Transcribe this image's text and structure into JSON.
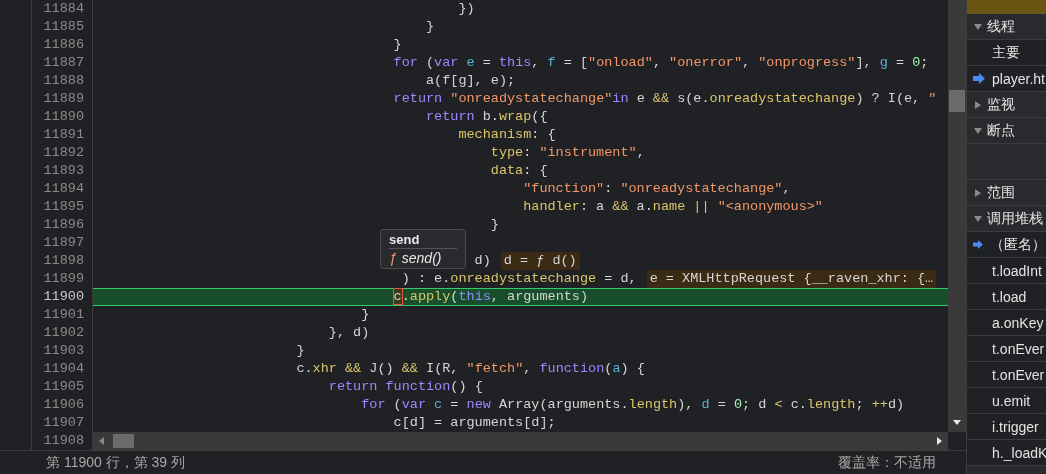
{
  "editor": {
    "lines": [
      {
        "number": "11884",
        "current": false,
        "tokens": [
          {
            "text": "                                            })",
            "kind": "plain"
          }
        ]
      },
      {
        "number": "11885",
        "current": false,
        "tokens": [
          {
            "text": "                                        }",
            "kind": "plain"
          }
        ]
      },
      {
        "number": "11886",
        "current": false,
        "tokens": [
          {
            "text": "                                    }",
            "kind": "plain"
          }
        ]
      },
      {
        "number": "11887",
        "current": false,
        "tokens": [
          {
            "text": "                                    for",
            "kind": "kw"
          },
          {
            "text": " (",
            "kind": "plain"
          },
          {
            "text": "var",
            "kind": "kw"
          },
          {
            "text": " e",
            "kind": "var"
          },
          {
            "text": " = ",
            "kind": "plain"
          },
          {
            "text": "this",
            "kind": "kw"
          },
          {
            "text": ", ",
            "kind": "plain"
          },
          {
            "text": "f",
            "kind": "var"
          },
          {
            "text": " = [",
            "kind": "plain"
          },
          {
            "text": "\"onload\"",
            "kind": "str"
          },
          {
            "text": ", ",
            "kind": "plain"
          },
          {
            "text": "\"onerror\"",
            "kind": "str"
          },
          {
            "text": ", ",
            "kind": "plain"
          },
          {
            "text": "\"onprogress\"",
            "kind": "str"
          },
          {
            "text": "], ",
            "kind": "plain"
          },
          {
            "text": "g",
            "kind": "var"
          },
          {
            "text": " = ",
            "kind": "plain"
          },
          {
            "text": "0",
            "kind": "num"
          },
          {
            "text": ";",
            "kind": "plain"
          }
        ]
      },
      {
        "number": "11888",
        "current": false,
        "tokens": [
          {
            "text": "                                        a(f[g], e);",
            "kind": "plain"
          }
        ]
      },
      {
        "number": "11889",
        "current": false,
        "tokens": [
          {
            "text": "                                    return",
            "kind": "kw"
          },
          {
            "text": " \"onreadystatechange\"",
            "kind": "str"
          },
          {
            "text": "in",
            "kind": "kw"
          },
          {
            "text": " e ",
            "kind": "plain"
          },
          {
            "text": "&&",
            "kind": "op"
          },
          {
            "text": " s(e.",
            "kind": "plain"
          },
          {
            "text": "onreadystatechange",
            "kind": "prop"
          },
          {
            "text": ") ? I(e, ",
            "kind": "plain"
          },
          {
            "text": "\"",
            "kind": "str"
          }
        ]
      },
      {
        "number": "11890",
        "current": false,
        "tokens": [
          {
            "text": "                                        return",
            "kind": "kw"
          },
          {
            "text": " b.",
            "kind": "plain"
          },
          {
            "text": "wrap",
            "kind": "prop"
          },
          {
            "text": "({",
            "kind": "plain"
          }
        ]
      },
      {
        "number": "11891",
        "current": false,
        "tokens": [
          {
            "text": "                                            mechanism",
            "kind": "prop"
          },
          {
            "text": ": {",
            "kind": "plain"
          }
        ]
      },
      {
        "number": "11892",
        "current": false,
        "tokens": [
          {
            "text": "                                                type",
            "kind": "prop"
          },
          {
            "text": ": ",
            "kind": "plain"
          },
          {
            "text": "\"instrument\"",
            "kind": "str"
          },
          {
            "text": ",",
            "kind": "plain"
          }
        ]
      },
      {
        "number": "11893",
        "current": false,
        "tokens": [
          {
            "text": "                                                data",
            "kind": "prop"
          },
          {
            "text": ": {",
            "kind": "plain"
          }
        ]
      },
      {
        "number": "11894",
        "current": false,
        "tokens": [
          {
            "text": "                                                    \"function\"",
            "kind": "str"
          },
          {
            "text": ": ",
            "kind": "plain"
          },
          {
            "text": "\"onreadystatechange\"",
            "kind": "str"
          },
          {
            "text": ",",
            "kind": "plain"
          }
        ]
      },
      {
        "number": "11895",
        "current": false,
        "tokens": [
          {
            "text": "                                                    handler",
            "kind": "prop"
          },
          {
            "text": ": a ",
            "kind": "plain"
          },
          {
            "text": "&&",
            "kind": "op"
          },
          {
            "text": " a.",
            "kind": "plain"
          },
          {
            "text": "name",
            "kind": "prop"
          },
          {
            "text": " ||",
            "kind": "op"
          },
          {
            "text": " \"<anonymous>\"",
            "kind": "str"
          }
        ]
      },
      {
        "number": "11896",
        "current": false,
        "tokens": [
          {
            "text": "                                                }",
            "kind": "plain"
          }
        ]
      },
      {
        "number": "11897",
        "current": false
      },
      {
        "number": "11898",
        "current": false,
        "tokens": [
          {
            "text": "                                              d)",
            "kind": "plain"
          }
        ],
        "inline_value": "d = ƒ d()"
      },
      {
        "number": "11899",
        "current": false,
        "tokens": [
          {
            "text": "                                     ) : e.",
            "kind": "plain"
          },
          {
            "text": "onreadystatechange",
            "kind": "prop"
          },
          {
            "text": " = d,",
            "kind": "plain"
          }
        ],
        "inline_value": "e = XMLHttpRequest {__raven_xhr: {…"
      },
      {
        "number": "11900",
        "current": true,
        "tokens": [
          {
            "text": "                                    c",
            "kind": "paused"
          },
          {
            "text": ".",
            "kind": "plain"
          },
          {
            "text": "apply",
            "kind": "prop"
          },
          {
            "text": "(",
            "kind": "plain"
          },
          {
            "text": "this",
            "kind": "kw"
          },
          {
            "text": ", arguments)",
            "kind": "plain"
          }
        ]
      },
      {
        "number": "11901",
        "current": false,
        "tokens": [
          {
            "text": "                                }",
            "kind": "plain"
          }
        ]
      },
      {
        "number": "11902",
        "current": false,
        "tokens": [
          {
            "text": "                            }, d)",
            "kind": "plain"
          }
        ]
      },
      {
        "number": "11903",
        "current": false,
        "tokens": [
          {
            "text": "                        }",
            "kind": "plain"
          }
        ]
      },
      {
        "number": "11904",
        "current": false,
        "tokens": [
          {
            "text": "                        c.",
            "kind": "plain"
          },
          {
            "text": "xhr",
            "kind": "prop"
          },
          {
            "text": " &&",
            "kind": "op"
          },
          {
            "text": " J() ",
            "kind": "plain"
          },
          {
            "text": "&&",
            "kind": "op"
          },
          {
            "text": " I(R, ",
            "kind": "plain"
          },
          {
            "text": "\"fetch\"",
            "kind": "str"
          },
          {
            "text": ", ",
            "kind": "plain"
          },
          {
            "text": "function",
            "kind": "kw"
          },
          {
            "text": "(",
            "kind": "plain"
          },
          {
            "text": "a",
            "kind": "var"
          },
          {
            "text": ") {",
            "kind": "plain"
          }
        ]
      },
      {
        "number": "11905",
        "current": false,
        "tokens": [
          {
            "text": "                            return",
            "kind": "kw"
          },
          {
            "text": " function",
            "kind": "kw"
          },
          {
            "text": "() {",
            "kind": "plain"
          }
        ]
      },
      {
        "number": "11906",
        "current": false,
        "tokens": [
          {
            "text": "                                for",
            "kind": "kw"
          },
          {
            "text": " (",
            "kind": "plain"
          },
          {
            "text": "var",
            "kind": "kw"
          },
          {
            "text": " c",
            "kind": "var"
          },
          {
            "text": " = ",
            "kind": "plain"
          },
          {
            "text": "new",
            "kind": "kw"
          },
          {
            "text": " Array(arguments.",
            "kind": "plain"
          },
          {
            "text": "length",
            "kind": "prop"
          },
          {
            "text": "), ",
            "kind": "plain"
          },
          {
            "text": "d",
            "kind": "var"
          },
          {
            "text": " = ",
            "kind": "plain"
          },
          {
            "text": "0",
            "kind": "num"
          },
          {
            "text": "; d ",
            "kind": "plain"
          },
          {
            "text": "<",
            "kind": "op"
          },
          {
            "text": " c.",
            "kind": "plain"
          },
          {
            "text": "length",
            "kind": "prop"
          },
          {
            "text": "; ",
            "kind": "plain"
          },
          {
            "text": "++",
            "kind": "op"
          },
          {
            "text": "d)",
            "kind": "plain"
          }
        ]
      },
      {
        "number": "11907",
        "current": false,
        "tokens": [
          {
            "text": "                                    c[d] = arguments[d];",
            "kind": "plain"
          }
        ]
      },
      {
        "number": "11908",
        "current": false
      }
    ],
    "tooltip": {
      "title": "send",
      "icon": "ƒ",
      "signature": "send()"
    }
  },
  "status_bar": {
    "position": "第 11900 行，第 39 列",
    "coverage": "覆盖率：不适用"
  },
  "sidebar": {
    "items": [
      {
        "kind": "section",
        "label": "线程",
        "expanded": true
      },
      {
        "kind": "entry",
        "label": "主要"
      },
      {
        "kind": "current",
        "label": "player.ht"
      },
      {
        "kind": "section",
        "label": "监视",
        "expanded": false
      },
      {
        "kind": "section",
        "label": "断点",
        "expanded": true
      },
      {
        "kind": "blank"
      },
      {
        "kind": "section",
        "label": "范围",
        "expanded": false
      },
      {
        "kind": "section",
        "label": "调用堆栈",
        "expanded": true
      },
      {
        "kind": "current",
        "label": "（匿名）"
      },
      {
        "kind": "entry",
        "label": "t.loadInt"
      },
      {
        "kind": "entry",
        "label": "t.load"
      },
      {
        "kind": "entry",
        "label": "a.onKey"
      },
      {
        "kind": "entry",
        "label": "t.onEver"
      },
      {
        "kind": "entry",
        "label": "t.onEver"
      },
      {
        "kind": "entry",
        "label": "u.emit"
      },
      {
        "kind": "entry",
        "label": "i.trigger"
      },
      {
        "kind": "entry",
        "label": "h._loadK"
      }
    ]
  }
}
